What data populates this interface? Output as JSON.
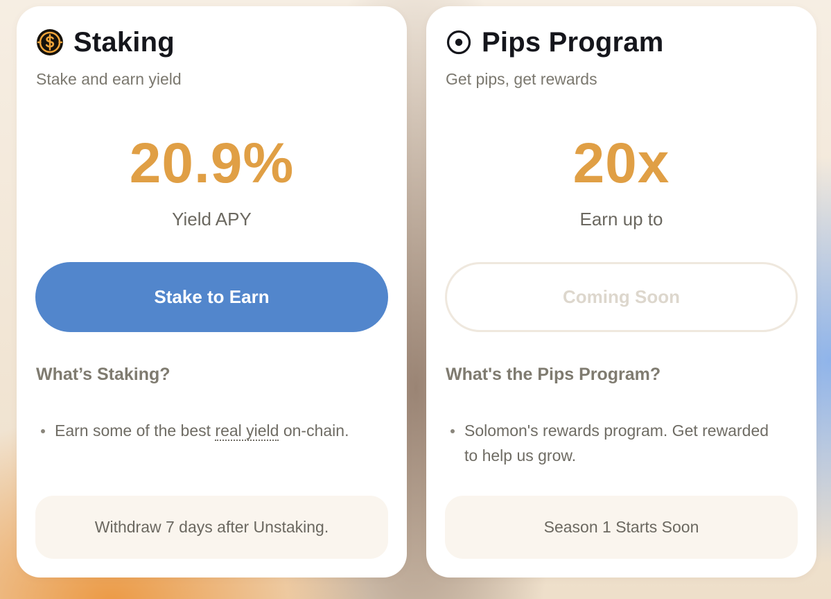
{
  "staking": {
    "title": "Staking",
    "icon": "dollar-coin-icon",
    "subtitle": "Stake and earn yield",
    "value": "20.9%",
    "value_label": "Yield APY",
    "button_label": "Stake to Earn",
    "section_heading": "What’s Staking?",
    "bullet": {
      "before": "Earn some of the best ",
      "link": "real yield",
      "after": " on-chain."
    },
    "note": "Withdraw 7 days after Unstaking."
  },
  "pips": {
    "title": "Pips Program",
    "icon": "target-icon",
    "subtitle": "Get pips, get rewards",
    "value": "20x",
    "value_label": "Earn up to",
    "button_label": "Coming Soon",
    "section_heading": "What's the Pips Program?",
    "bullet": "Solomon's rewards program. Get rewarded to help us grow.",
    "note": "Season 1 Starts Soon"
  },
  "colors": {
    "accent": "#e09f45",
    "primary_button": "#5286cc",
    "title": "#15161c",
    "muted_text": "#7b786f"
  }
}
